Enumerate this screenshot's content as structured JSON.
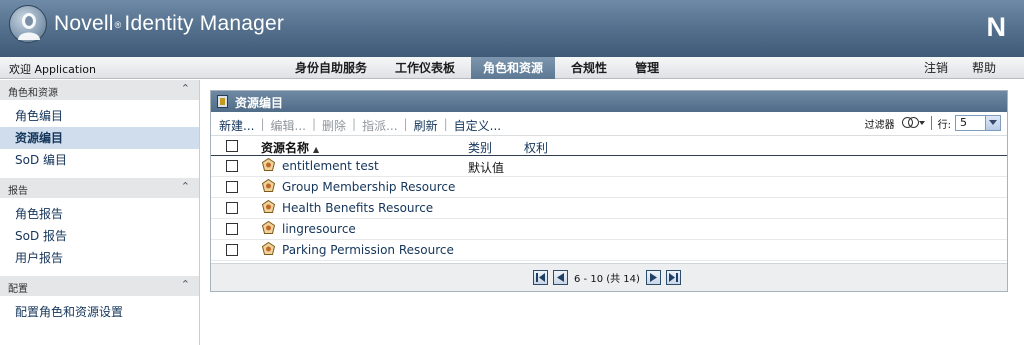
{
  "header": {
    "brand": "Novell",
    "product": "Identity Manager",
    "corner_logo": "N"
  },
  "nav": {
    "welcome": "欢迎 Application",
    "tabs": [
      {
        "label": "身份自助服务",
        "active": false
      },
      {
        "label": "工作仪表板",
        "active": false
      },
      {
        "label": "角色和资源",
        "active": true
      },
      {
        "label": "合规性",
        "active": false
      },
      {
        "label": "管理",
        "active": false
      }
    ],
    "logout": "注销",
    "help": "帮助"
  },
  "sidebar": {
    "sections": [
      {
        "title": "角色和资源",
        "items": [
          {
            "label": "角色编目",
            "selected": false
          },
          {
            "label": "资源编目",
            "selected": true
          },
          {
            "label": "SoD 编目",
            "selected": false
          }
        ]
      },
      {
        "title": "报告",
        "items": [
          {
            "label": "角色报告",
            "selected": false
          },
          {
            "label": "SoD 报告",
            "selected": false
          },
          {
            "label": "用户报告",
            "selected": false
          }
        ]
      },
      {
        "title": "配置",
        "items": [
          {
            "label": "配置角色和资源设置",
            "selected": false
          }
        ]
      }
    ]
  },
  "panel": {
    "title": "资源编目",
    "actions": {
      "new": "新建...",
      "edit": "编辑...",
      "delete": "删除",
      "assign": "指派...",
      "refresh": "刷新",
      "customize": "自定义..."
    },
    "filter_label": "过滤器",
    "rows_label": "行:",
    "rows_value": "5",
    "columns": {
      "name": "资源名称",
      "category": "类别",
      "rights": "权利"
    },
    "rows": [
      {
        "name": "entitlement test",
        "category": "默认值"
      },
      {
        "name": "Group Membership Resource",
        "category": ""
      },
      {
        "name": "Health Benefits Resource",
        "category": ""
      },
      {
        "name": "lingresource",
        "category": ""
      },
      {
        "name": "Parking Permission Resource",
        "category": ""
      }
    ],
    "pager": {
      "info": "6 - 10 (共 14)"
    }
  },
  "colors": {
    "header_blue": "#56728f",
    "active_tab": "#6a859f",
    "selected_item": "#cfdded",
    "link": "#14355a"
  }
}
